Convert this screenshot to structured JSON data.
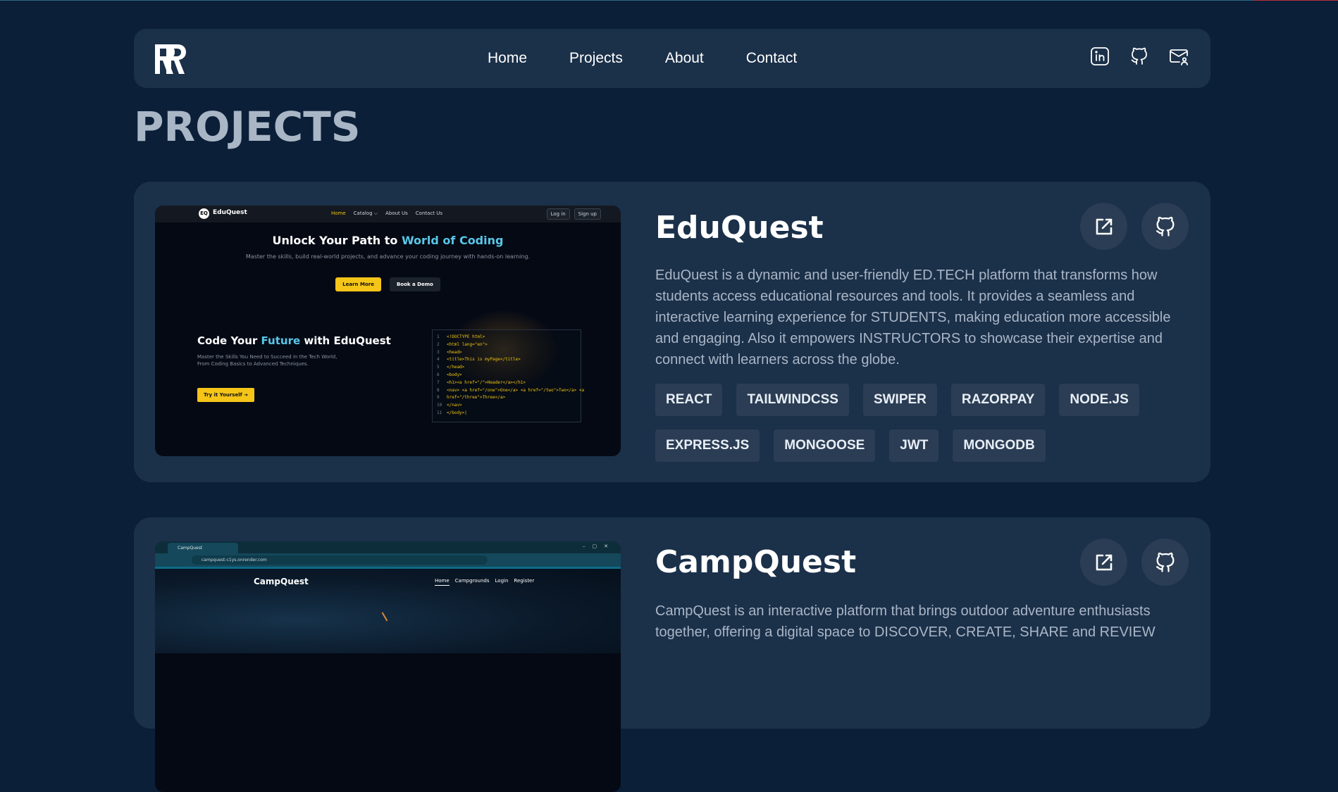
{
  "nav": {
    "links": [
      "Home",
      "Projects",
      "About",
      "Contact"
    ],
    "icons": [
      "linkedin-icon",
      "github-icon",
      "mail-icon"
    ]
  },
  "page_title": "PROJECTS",
  "projects": [
    {
      "title": "EduQuest",
      "description": "EduQuest is a dynamic and user-friendly ED.TECH platform that transforms how students access educational resources and tools. It provides a seamless and interactive learning experience for STUDENTS, making education more accessible and engaging. Also it empowers INSTRUCTORS to showcase their expertise and connect with learners across the globe.",
      "tags": [
        "REACT",
        "TAILWINDCSS",
        "SWIPER",
        "RAZORPAY",
        "NODE.JS",
        "EXPRESS.JS",
        "MONGOOSE",
        "JWT",
        "MONGODB"
      ],
      "screenshot": {
        "logo_badge": "EQ",
        "brand": "EduQuest",
        "nav": [
          "Home",
          "Catalog ⌵",
          "About Us",
          "Contact Us"
        ],
        "auth": [
          "Log in",
          "Sign up"
        ],
        "hero_prefix": "Unlock Your Path to ",
        "hero_highlight": "World of Coding",
        "hero_sub": "Master the skills, build real-world projects, and advance your coding journey with hands-on learning.",
        "btn_primary": "Learn More",
        "btn_secondary": "Book a Demo",
        "section_prefix": "Code Your ",
        "section_highlight": "Future",
        "section_suffix": " with EduQuest",
        "section_text": "Master the Skills You Need to Succeed in the Tech World, From Coding Basics to Advanced Techniques.",
        "try_btn": "Try it Yourself ➔",
        "code_lines": [
          "<!DOCTYPE html>",
          "<html lang=\"en\">",
          "<head>",
          "<title>This is myPage</title>",
          "</head>",
          "<body>",
          "<h1><a href=\"/\">Header</a></h1>",
          "<nav> <a href=\"/one\">One</a> <a href=\"/two\">Two</a> <a",
          "href=\"/three\">Three</a>",
          "</nav>",
          "</body>|"
        ]
      }
    },
    {
      "title": "CampQuest",
      "description": "CampQuest is an interactive platform that brings outdoor adventure enthusiasts together, offering a digital space to DISCOVER, CREATE, SHARE and REVIEW",
      "screenshot": {
        "tab_title": "CampQuest",
        "url": "campquest-c1ys.onrender.com",
        "brand": "CampQuest",
        "nav": [
          "Home",
          "Campgrounds",
          "Login",
          "Register"
        ]
      }
    }
  ],
  "colors": {
    "background": "#0b1f38",
    "card": "#1b3049",
    "chip": "#2b3d54",
    "accent_yellow": "#f5c518",
    "accent_cyan": "#59c7e8"
  }
}
